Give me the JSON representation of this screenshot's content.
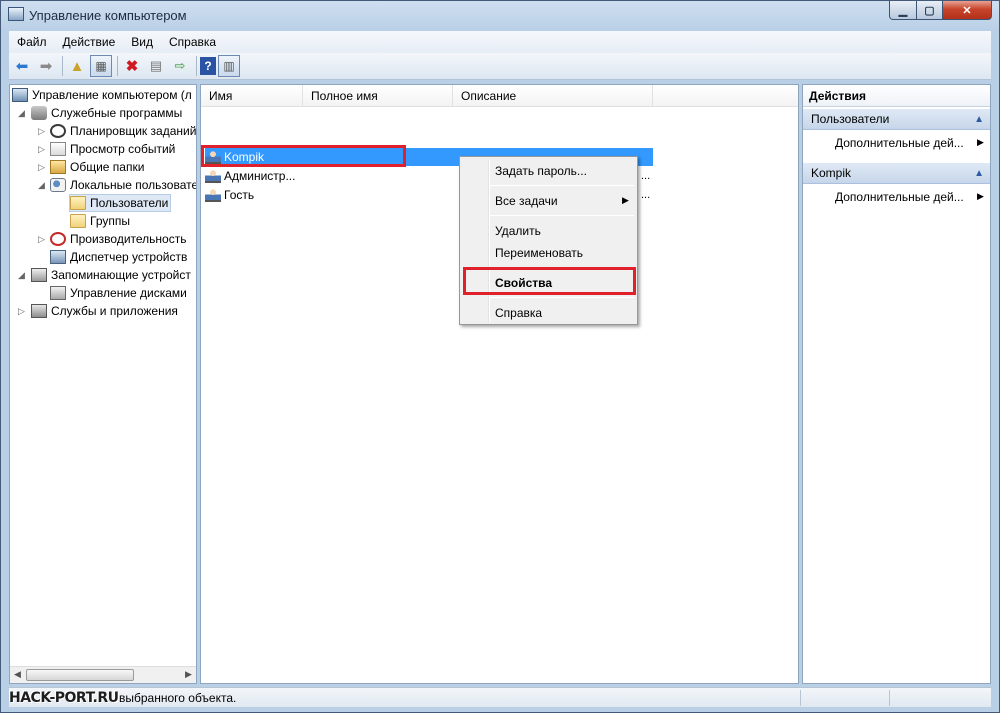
{
  "window": {
    "title": "Управление компьютером"
  },
  "menubar": {
    "items": [
      "Файл",
      "Действие",
      "Вид",
      "Справка"
    ]
  },
  "toolbar": {
    "icons": [
      "back-icon",
      "forward-icon",
      "up-folder-icon",
      "show-tree-icon",
      "delete-icon",
      "properties-icon",
      "export-icon",
      "help-icon",
      "action-pane-icon"
    ]
  },
  "tree": {
    "items": [
      {
        "label": "Управление компьютером (л",
        "icon": "computer-icon"
      },
      {
        "label": "Служебные программы",
        "icon": "tools-icon"
      },
      {
        "label": "Планировщик заданий",
        "icon": "clock-icon"
      },
      {
        "label": "Просмотр событий",
        "icon": "event-viewer-icon"
      },
      {
        "label": "Общие папки",
        "icon": "shared-folder-icon"
      },
      {
        "label": "Локальные пользовате",
        "icon": "local-users-icon"
      },
      {
        "label": "Пользователи",
        "icon": "folder-icon",
        "selected": true
      },
      {
        "label": "Группы",
        "icon": "folder-icon"
      },
      {
        "label": "Производительность",
        "icon": "performance-icon"
      },
      {
        "label": "Диспетчер устройств",
        "icon": "device-manager-icon"
      },
      {
        "label": "Запоминающие устройст",
        "icon": "storage-icon"
      },
      {
        "label": "Управление дисками",
        "icon": "disk-icon"
      },
      {
        "label": "Службы и приложения",
        "icon": "services-icon"
      }
    ]
  },
  "list": {
    "columns": [
      "Имя",
      "Полное имя",
      "Описание"
    ],
    "rows": [
      {
        "name": "Kompik",
        "selected": true
      },
      {
        "name": "Администр...",
        "trailing": "..."
      },
      {
        "name": "Гость",
        "trailing": "..."
      }
    ]
  },
  "context_menu": {
    "items": [
      "Задать пароль...",
      "Все задачи",
      "Удалить",
      "Переименовать",
      "Свойства",
      "Справка"
    ],
    "bold_item": "Свойства"
  },
  "actions": {
    "header": "Действия",
    "sections": [
      {
        "title": "Пользователи",
        "item": "Дополнительные дей..."
      },
      {
        "title": "Kompik",
        "item": "Дополнительные дей..."
      }
    ]
  },
  "statusbar": {
    "text": "выбранного объекта.",
    "watermark": "HACK-PORT.RU"
  },
  "colors": {
    "selection": "#3399ff",
    "highlight_box": "#e0202b",
    "close_button": "#c8452c"
  }
}
